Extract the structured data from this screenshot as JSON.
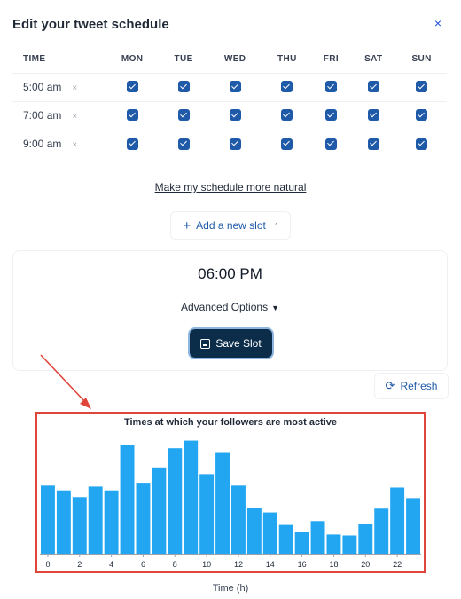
{
  "header": {
    "title": "Edit your tweet schedule",
    "close": "×"
  },
  "schedule": {
    "time_header": "TIME",
    "days": [
      "MON",
      "TUE",
      "WED",
      "THU",
      "FRI",
      "SAT",
      "SUN"
    ],
    "remove_symbol": "×",
    "rows": [
      {
        "time": "5:00 am",
        "checked": [
          true,
          true,
          true,
          true,
          true,
          true,
          true
        ]
      },
      {
        "time": "7:00 am",
        "checked": [
          true,
          true,
          true,
          true,
          true,
          true,
          true
        ]
      },
      {
        "time": "9:00 am",
        "checked": [
          true,
          true,
          true,
          true,
          true,
          true,
          true
        ]
      }
    ]
  },
  "natural_link": "Make my schedule more natural",
  "add_slot": {
    "label": "Add a new slot",
    "icon": "plus-icon",
    "chevron": "chevron-up-icon"
  },
  "slot": {
    "time": "06:00 PM",
    "advanced_label": "Advanced Options",
    "save_label": "Save Slot"
  },
  "refresh": {
    "label": "Refresh",
    "icon": "refresh-icon"
  },
  "chart_data": {
    "type": "bar",
    "title": "Times at which your followers are most active",
    "xlabel": "Time (h)",
    "ylabel": "",
    "color": "#22a6f2",
    "categories": [
      0,
      1,
      2,
      3,
      4,
      5,
      6,
      7,
      8,
      9,
      10,
      11,
      12,
      13,
      14,
      15,
      16,
      17,
      18,
      19,
      20,
      21,
      22,
      23
    ],
    "x_ticks": [
      "0",
      "2",
      "4",
      "6",
      "8",
      "10",
      "12",
      "14",
      "16",
      "18",
      "20",
      "22"
    ],
    "values": [
      71,
      66,
      59,
      70,
      66,
      113,
      74,
      90,
      110,
      118,
      83,
      106,
      71,
      48,
      43,
      30,
      23,
      34,
      20,
      19,
      31,
      47,
      69,
      58
    ],
    "ylim": [
      0,
      125
    ]
  }
}
